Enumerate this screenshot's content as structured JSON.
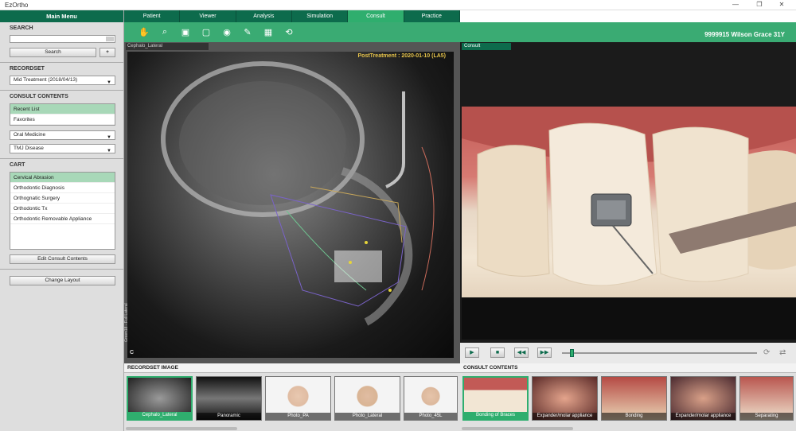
{
  "window": {
    "title": "EzOrtho",
    "minimize": "—",
    "maximize": "❐",
    "close": "✕"
  },
  "sidebar": {
    "main_menu": "Main Menu",
    "search": {
      "title": "SEARCH",
      "value": "",
      "button": "Search",
      "add": "+"
    },
    "recordset": {
      "title": "RECORDSET",
      "selected": "Mid Treatment (2018/04/13)"
    },
    "consult_contents": {
      "title": "CONSULT CONTENTS",
      "items": [
        {
          "label": "Recent List"
        },
        {
          "label": "Favorites"
        }
      ],
      "dropdown1": "Oral Medicine",
      "dropdown2": "TMJ Disease"
    },
    "cart": {
      "title": "CART",
      "items": [
        {
          "label": "Cervical Abrasion"
        },
        {
          "label": "Orthodontic Diagnosis"
        },
        {
          "label": "Orthognatic Surgery"
        },
        {
          "label": "Orthodontic Tx"
        },
        {
          "label": "Orthodontic Removable Appliance"
        }
      ],
      "edit_button": "Edit Consult Contents"
    },
    "change_layout": "Change Layout"
  },
  "tabs": [
    {
      "label": "Patient"
    },
    {
      "label": "Viewer"
    },
    {
      "label": "Analysis"
    },
    {
      "label": "Simulation"
    },
    {
      "label": "Consult"
    },
    {
      "label": "Practice"
    }
  ],
  "patient": {
    "label": "9999915  Wilson Grace 31Y"
  },
  "ceph": {
    "panel_title": "Cephalo_Lateral",
    "post_treatment": "PostTreatment : 2020-01-10 (LA5)",
    "vertical_label": "Green18 - Full Lateral",
    "corner": "C"
  },
  "consult": {
    "panel_title": "Consult"
  },
  "recordset_images": {
    "title": "RECORDSET IMAGE",
    "items": [
      {
        "label": "Cephalo_Lateral"
      },
      {
        "label": "Panoramic"
      },
      {
        "label": "Photo_PA"
      },
      {
        "label": "Photo_Lateral"
      },
      {
        "label": "Photo_45L"
      }
    ]
  },
  "consult_thumbs": {
    "title": "CONSULT CONTENTS",
    "items": [
      {
        "label": "Bonding of Braces"
      },
      {
        "label": "Expander/molar appliance"
      },
      {
        "label": "Bonding"
      },
      {
        "label": "Expander/molar appliance"
      },
      {
        "label": "Separating"
      }
    ]
  },
  "colors": {
    "accent": "#2fae6e",
    "dark": "#0d6b4c"
  }
}
